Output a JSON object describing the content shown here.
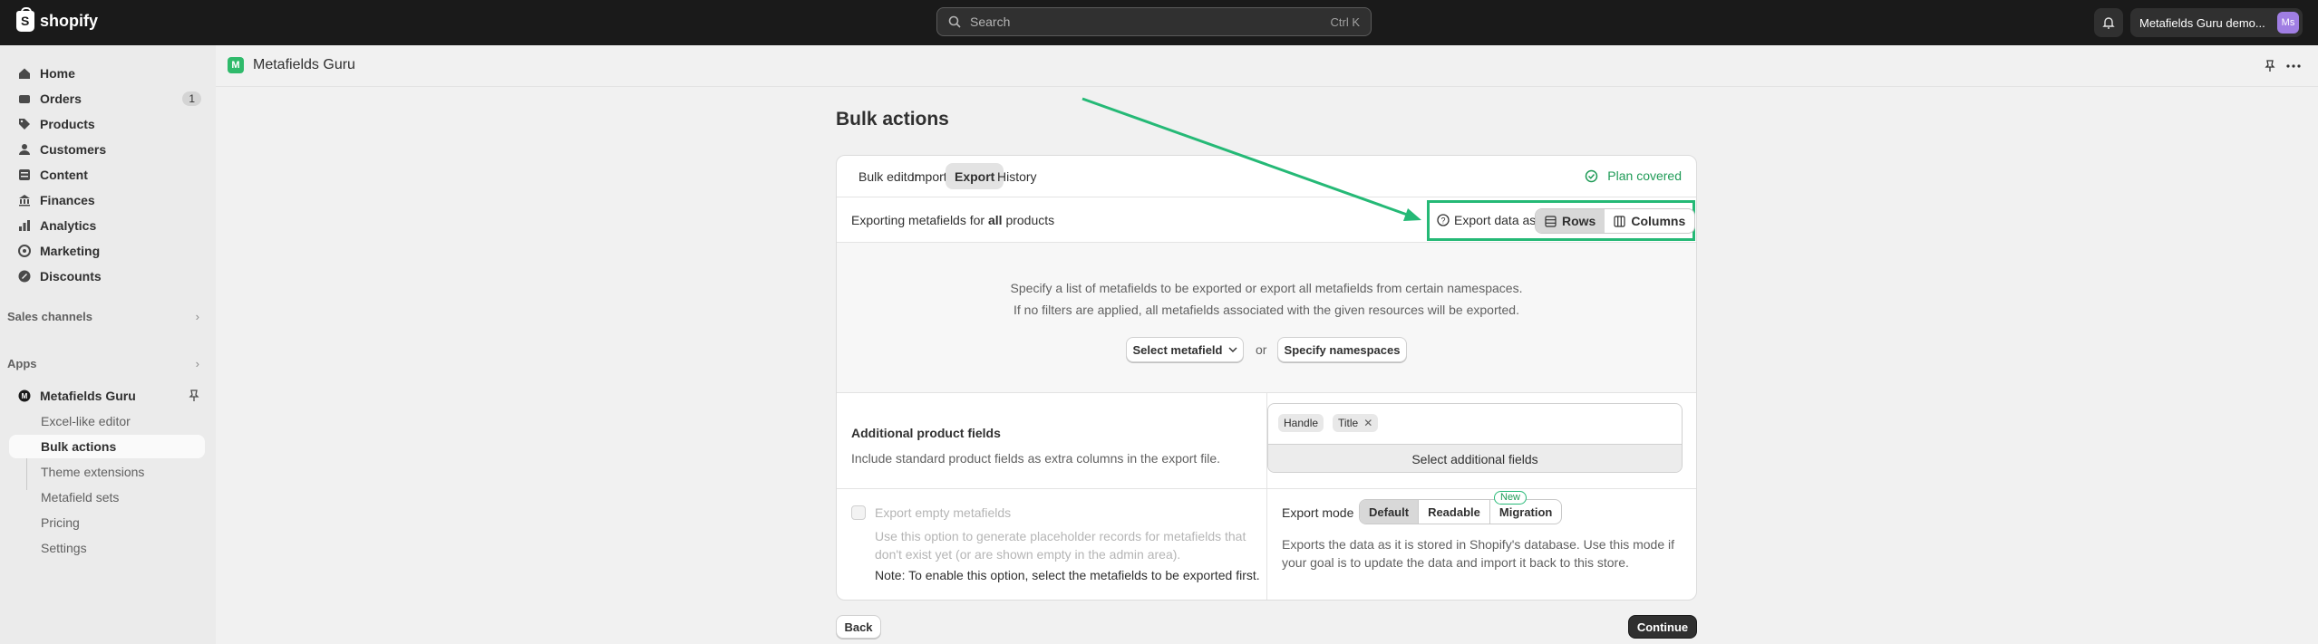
{
  "topbar": {
    "brand": "shopify",
    "search_placeholder": "Search",
    "search_shortcut": "Ctrl K",
    "store_name": "Metafields Guru demo...",
    "avatar_initials": "Ms"
  },
  "sidebar": {
    "items": [
      {
        "label": "Home",
        "icon": "home-icon"
      },
      {
        "label": "Orders",
        "icon": "orders-icon",
        "badge": "1"
      },
      {
        "label": "Products",
        "icon": "tag-icon"
      },
      {
        "label": "Customers",
        "icon": "person-icon"
      },
      {
        "label": "Content",
        "icon": "content-icon"
      },
      {
        "label": "Finances",
        "icon": "bank-icon"
      },
      {
        "label": "Analytics",
        "icon": "chart-icon"
      },
      {
        "label": "Marketing",
        "icon": "target-icon"
      },
      {
        "label": "Discounts",
        "icon": "discount-icon"
      }
    ],
    "sales_channels": "Sales channels",
    "apps": "Apps",
    "app_name": "Metafields Guru",
    "sub_items": [
      "Excel-like editor",
      "Bulk actions",
      "Theme extensions",
      "Metafield sets",
      "Pricing",
      "Settings"
    ]
  },
  "appbar": {
    "title": "Metafields Guru"
  },
  "page": {
    "title": "Bulk actions",
    "tabs": [
      "Bulk editor",
      "Import",
      "Export",
      "History"
    ],
    "plan": "Plan covered",
    "export_text_prefix": "Exporting metafields for",
    "export_text_bold": "all",
    "export_text_suffix": "products",
    "export_as_label": "Export data as",
    "export_as_options": [
      "Rows",
      "Columns"
    ],
    "hint_line1": "Specify a list of metafields to be exported or export all metafields from certain namespaces.",
    "hint_line2": "If no filters are applied, all metafields associated with the given resources will be exported.",
    "select_metafield": "Select metafield",
    "or": "or",
    "specify_namespaces": "Specify namespaces",
    "additional_title": "Additional product fields",
    "additional_desc": "Include standard product fields as extra columns in the export file.",
    "chips": [
      "Handle",
      "Title"
    ],
    "select_additional": "Select additional fields",
    "empty_label": "Export empty metafields",
    "empty_help": "Use this option to generate placeholder records for metafields that don't exist yet (or are shown empty in the admin area).",
    "empty_note": "Note: To enable this option, select the metafields to be exported first.",
    "mode_label": "Export mode",
    "modes": [
      "Default",
      "Readable",
      "Migration"
    ],
    "new_badge": "New",
    "mode_desc": "Exports the data as it is stored in Shopify's database. Use this mode if your goal is to update the data and import it back to this store.",
    "back": "Back",
    "continue": "Continue"
  },
  "colors": {
    "accent": "#25b976",
    "topbar": "#1a1a1a",
    "primary_button": "#303030"
  }
}
